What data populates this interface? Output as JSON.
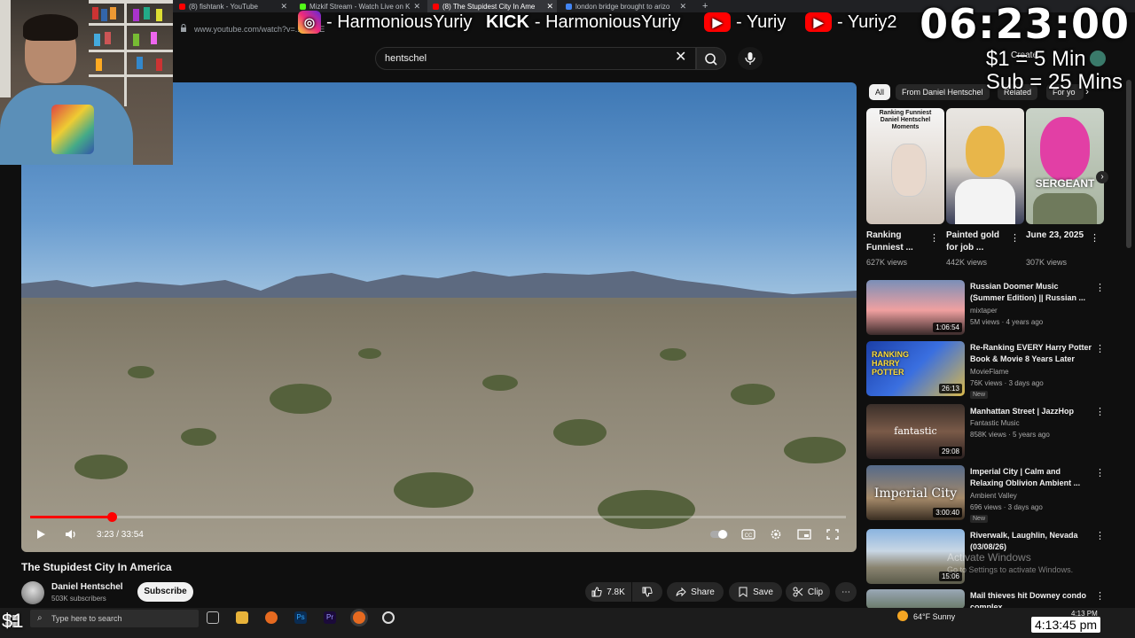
{
  "browser": {
    "tabs": [
      {
        "label": "(8) fishtank - YouTube",
        "color": "#ff0000"
      },
      {
        "label": "Mizkif Stream - Watch Live on K",
        "color": "#53fc18"
      },
      {
        "label": "(8) The Stupidest City In Ame",
        "color": "#ff0000"
      },
      {
        "label": "london bridge brought to arizo",
        "color": "#4285f4"
      }
    ],
    "url": "www.youtube.com/watch?v=...W6UE"
  },
  "overlay": {
    "instagram": "- HarmoniousYuriy",
    "kick_logo": "KICK",
    "kick": "- HarmoniousYuriy",
    "youtube1": "- Yuriy",
    "youtube2": "- Yuriy2",
    "clock": "06:23:00",
    "donation_line1": "$1 = 5 Min",
    "donation_line2": "Sub = 25 Mins",
    "dollar_badge": "$1",
    "stream_time": "4:13:45 pm"
  },
  "search": {
    "query": "hentschel"
  },
  "header": {
    "create_label": "Create"
  },
  "player": {
    "time": "3:23 / 33:54",
    "progress_fraction": 0.1
  },
  "video": {
    "title": "The Stupidest City In America",
    "channel": "Daniel Hentschel",
    "subscribers": "503K subscribers",
    "subscribe_label": "Subscribe",
    "likes": "7.8K",
    "share_label": "Share",
    "save_label": "Save",
    "clip_label": "Clip"
  },
  "chips": [
    "All",
    "From Daniel Hentschel",
    "Related",
    "For yo"
  ],
  "shorts": [
    {
      "title": "Ranking Funniest ...",
      "views": "627K views",
      "thumb_text": "Ranking Funniest Daniel Hentschel Moments"
    },
    {
      "title": "Painted gold for job ...",
      "views": "442K views",
      "thumb_text": ""
    },
    {
      "title": "June 23, 2025",
      "views": "307K views",
      "thumb_text": "SERGEANT"
    }
  ],
  "recommended": [
    {
      "title": "Russian Doomer Music (Summer Edition) || Russian ...",
      "channel": "mixtaper",
      "meta": "5M views · 4 years ago",
      "duration": "1:06:54",
      "badge": ""
    },
    {
      "title": "Re-Ranking EVERY Harry Potter Book & Movie 8 Years Later",
      "channel": "MovieFlame",
      "meta": "76K views · 3 days ago",
      "duration": "26:13",
      "badge": "New",
      "thumb_text": "RANKING HARRY POTTER"
    },
    {
      "title": "Manhattan Street | JazzHop",
      "channel": "Fantastic Music",
      "meta": "858K views · 5 years ago",
      "duration": "29:08",
      "badge": "",
      "thumb_text": "fantastic"
    },
    {
      "title": "Imperial City | Calm and Relaxing Oblivion Ambient ...",
      "channel": "Ambient Valley",
      "meta": "696 views · 3 days ago",
      "duration": "3:00:40",
      "badge": "New",
      "thumb_text": "Imperial City"
    },
    {
      "title": "Riverwalk, Laughlin, Nevada (03/08/26)",
      "channel": "",
      "meta": "",
      "duration": "15:06",
      "badge": ""
    },
    {
      "title": "Mail thieves hit Downey condo complex",
      "channel": "",
      "meta": "",
      "duration": "",
      "badge": ""
    }
  ],
  "watermark": {
    "line1": "Activate Windows",
    "line2": "Go to Settings to activate Windows."
  },
  "taskbar": {
    "search_placeholder": "Type here to search",
    "weather": "64°F  Sunny",
    "clock": "4:13 PM"
  }
}
